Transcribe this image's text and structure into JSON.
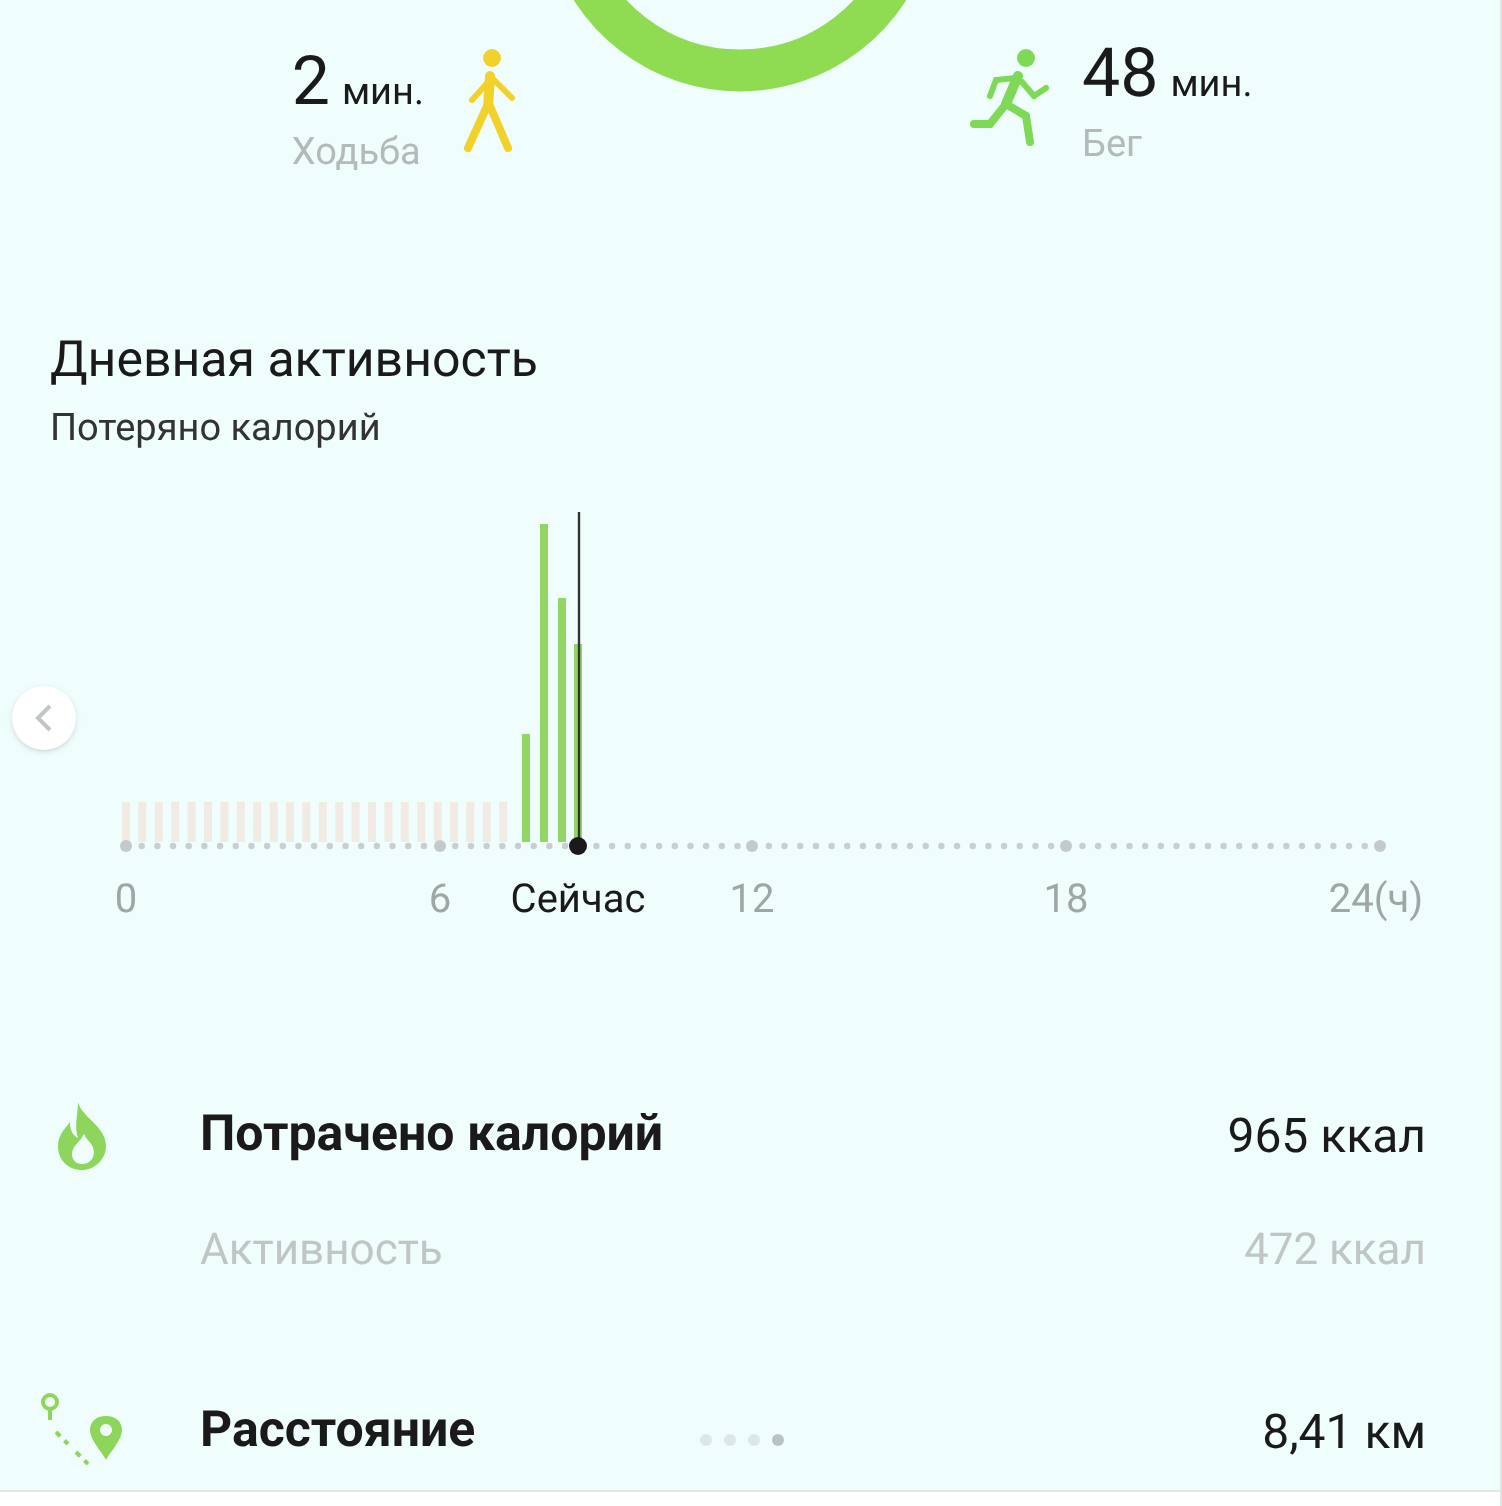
{
  "summary": {
    "walking": {
      "value": "2",
      "unit": "мин.",
      "label": "Ходьба"
    },
    "running": {
      "value": "48",
      "unit": "мин.",
      "label": "Бег"
    }
  },
  "daily_activity": {
    "title": "Дневная активность",
    "subtitle": "Потеряно калорий",
    "axis_labels": [
      {
        "text": "0",
        "kind": "tick"
      },
      {
        "text": "6",
        "kind": "tick"
      },
      {
        "text": "Сейчас",
        "kind": "now"
      },
      {
        "text": "12",
        "kind": "tick"
      },
      {
        "text": "18",
        "kind": "tick"
      },
      {
        "text": "24(ч)",
        "kind": "tick"
      }
    ]
  },
  "stats": [
    {
      "kind": "calories",
      "label": "Потрачено калорий",
      "value": "965 ккал"
    },
    {
      "kind": "sub",
      "label": "Активность",
      "value": "472 ккал"
    },
    {
      "kind": "distance",
      "label": "Расстояние",
      "value": "8,41 км"
    }
  ],
  "pages": [
    {
      "selected": false
    },
    {
      "selected": false
    },
    {
      "selected": false
    },
    {
      "selected": true
    }
  ]
}
